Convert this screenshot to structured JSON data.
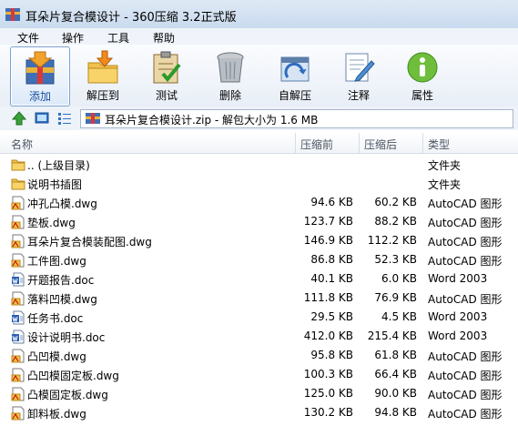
{
  "window": {
    "title": "耳朵片复合模设计 - 360压缩 3.2正式版"
  },
  "menu": [
    "文件",
    "操作",
    "工具",
    "帮助"
  ],
  "toolbar": [
    {
      "label": "添加",
      "icon": "add-archive-icon",
      "active": true
    },
    {
      "label": "解压到",
      "icon": "extract-to-icon",
      "active": false
    },
    {
      "label": "测试",
      "icon": "test-clipboard-icon",
      "active": false
    },
    {
      "label": "删除",
      "icon": "delete-trash-icon",
      "active": false
    },
    {
      "label": "自解压",
      "icon": "self-extract-icon",
      "active": false
    },
    {
      "label": "注释",
      "icon": "comment-icon",
      "active": false
    },
    {
      "label": "属性",
      "icon": "info-icon",
      "active": false
    }
  ],
  "addressbar": {
    "path": "耳朵片复合模设计.zip - 解包大小为 1.6 MB"
  },
  "columns": {
    "name": "名称",
    "compressed": "压缩前",
    "original": "压缩后",
    "type": "类型"
  },
  "files": [
    {
      "name": ".. (上级目录)",
      "compressed": "",
      "original": "",
      "type": "文件夹",
      "icon": "folder-icon"
    },
    {
      "name": "说明书插图",
      "compressed": "",
      "original": "",
      "type": "文件夹",
      "icon": "folder-icon"
    },
    {
      "name": "冲孔凸模.dwg",
      "compressed": "94.6 KB",
      "original": "60.2 KB",
      "type": "AutoCAD 图形",
      "icon": "dwg-file-icon"
    },
    {
      "name": "垫板.dwg",
      "compressed": "123.7 KB",
      "original": "88.2 KB",
      "type": "AutoCAD 图形",
      "icon": "dwg-file-icon"
    },
    {
      "name": "耳朵片复合模装配图.dwg",
      "compressed": "146.9 KB",
      "original": "112.2 KB",
      "type": "AutoCAD 图形",
      "icon": "dwg-file-icon"
    },
    {
      "name": "工件图.dwg",
      "compressed": "86.8 KB",
      "original": "52.3 KB",
      "type": "AutoCAD 图形",
      "icon": "dwg-file-icon"
    },
    {
      "name": "开题报告.doc",
      "compressed": "40.1 KB",
      "original": "6.0 KB",
      "type": "Word 2003",
      "icon": "word-doc-icon"
    },
    {
      "name": "落料凹模.dwg",
      "compressed": "111.8 KB",
      "original": "76.9 KB",
      "type": "AutoCAD 图形",
      "icon": "dwg-file-icon"
    },
    {
      "name": "任务书.doc",
      "compressed": "29.5 KB",
      "original": "4.5 KB",
      "type": "Word 2003",
      "icon": "word-doc-icon"
    },
    {
      "name": "设计说明书.doc",
      "compressed": "412.0 KB",
      "original": "215.4 KB",
      "type": "Word 2003",
      "icon": "word-doc-icon"
    },
    {
      "name": "凸凹模.dwg",
      "compressed": "95.8 KB",
      "original": "61.8 KB",
      "type": "AutoCAD 图形",
      "icon": "dwg-file-icon"
    },
    {
      "name": "凸凹模固定板.dwg",
      "compressed": "100.3 KB",
      "original": "66.4 KB",
      "type": "AutoCAD 图形",
      "icon": "dwg-file-icon"
    },
    {
      "name": "凸模固定板.dwg",
      "compressed": "125.0 KB",
      "original": "90.0 KB",
      "type": "AutoCAD 图形",
      "icon": "dwg-file-icon"
    },
    {
      "name": "卸料板.dwg",
      "compressed": "130.2 KB",
      "original": "94.8 KB",
      "type": "AutoCAD 图形",
      "icon": "dwg-file-icon"
    }
  ]
}
